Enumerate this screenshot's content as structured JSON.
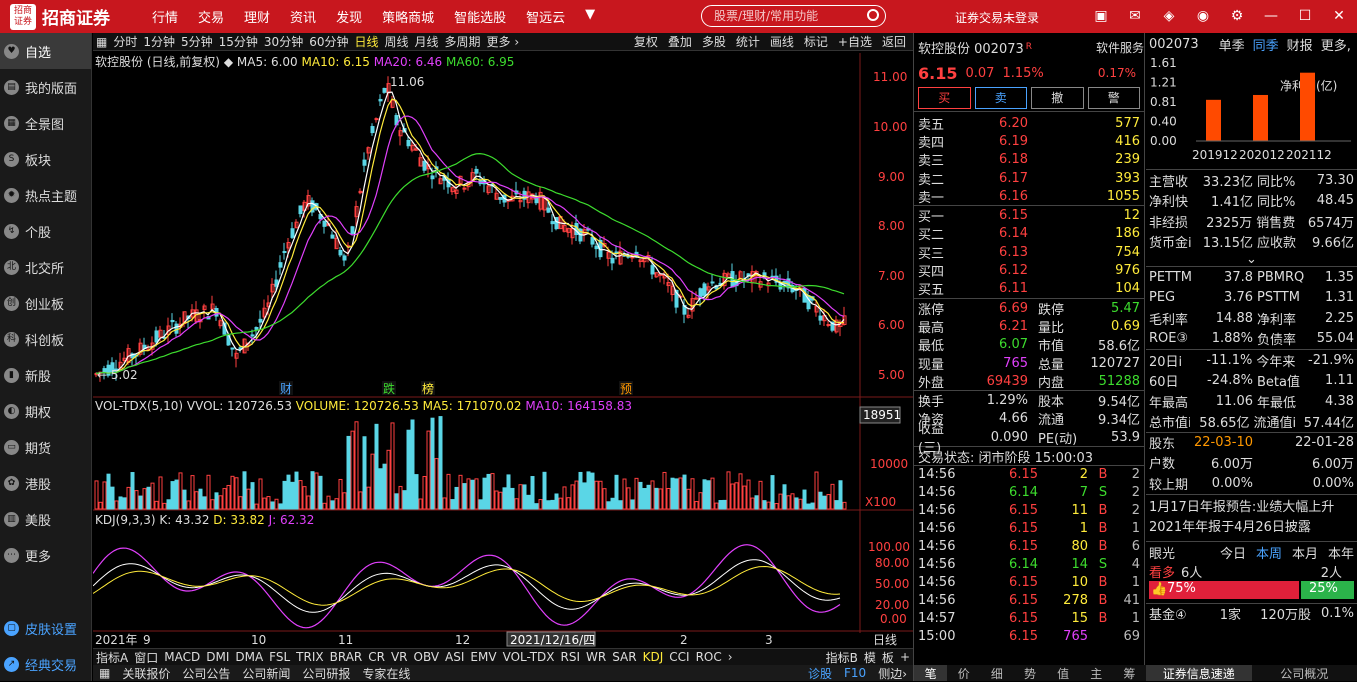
{
  "app": {
    "logo_mark": "招商证券",
    "logo": "招商证券",
    "nav": [
      "行情",
      "交易",
      "理财",
      "资讯",
      "发现",
      "策略商城",
      "智能选股",
      "智远云"
    ],
    "search_placeholder": "股票/理财/常用功能",
    "login": "证券交易未登录"
  },
  "sidebar": {
    "items": [
      "自选",
      "我的版面",
      "全景图",
      "板块",
      "热点主题",
      "个股",
      "北交所",
      "创业板",
      "科创板",
      "新股",
      "期权",
      "期货",
      "港股",
      "美股",
      "更多"
    ],
    "bottom": [
      "皮肤设置",
      "经典交易"
    ]
  },
  "chart": {
    "toolbar": [
      "分时",
      "1分钟",
      "5分钟",
      "15分钟",
      "30分钟",
      "60分钟",
      "日线",
      "周线",
      "月线",
      "多周期",
      "更多 ›"
    ],
    "toolbar_selected": "日线",
    "toolbar_right": [
      "复权",
      "叠加",
      "多股",
      "统计",
      "画线",
      "标记",
      "+自选",
      "返回"
    ],
    "title": "软控股份 (日线,前复权)",
    "ma5": "MA5: 6.00",
    "ma10": "MA10: 6.15",
    "ma20": "MA20: 6.46",
    "ma60": "MA60: 6.95",
    "high_label": "11.06",
    "low_label": "← 5.02",
    "price_axis": [
      "11.00",
      "10.00",
      "9.00",
      "8.00",
      "7.00",
      "6.00",
      "5.00"
    ],
    "markers": [
      "财",
      "跌",
      "榜",
      "预"
    ],
    "vol": {
      "name": "VOL-TDX(5,10)",
      "vvol": "VVOL: 120726.53",
      "volume": "VOLUME: 120726.53",
      "ma5": "MA5: 171070.02",
      "ma10": "MA10: 164158.83",
      "axis_top": "18951",
      "axis_mid": "10000",
      "unit": "X100"
    },
    "kdj": {
      "name": "KDJ(9,3,3)",
      "k": "K: 43.32",
      "d": "D: 33.82",
      "j": "J: 62.32",
      "axis": [
        "100.00",
        "80.00",
        "50.00",
        "20.00",
        "0.00"
      ]
    },
    "dates": {
      "year": "2021年",
      "m9": "9",
      "m10": "10",
      "m11": "11",
      "m12": "12",
      "cursor": "2021/12/16/四",
      "m2": "2",
      "m3": "3",
      "period": "日线"
    },
    "indicator_tabs": [
      "指标A",
      "窗口",
      "MACD",
      "DMI",
      "DMA",
      "FSL",
      "TRIX",
      "BRAR",
      "CR",
      "VR",
      "OBV",
      "ASI",
      "EMV",
      "VOL-TDX",
      "RSI",
      "WR",
      "SAR",
      "KDJ",
      "CCI",
      "ROC",
      "›"
    ],
    "indicator_selected": "KDJ",
    "indicator_right": [
      "指标B",
      "模",
      "板",
      "+"
    ],
    "news": [
      "关联报价",
      "公司公告",
      "公司新闻",
      "公司研报",
      "专家在线"
    ],
    "news_right": [
      "诊股",
      "F10",
      "侧边›"
    ]
  },
  "quote": {
    "name": "软控股份 002073",
    "badge": "R",
    "service": "软件服务",
    "price": "6.15",
    "change": "0.07",
    "pct": "1.15%",
    "sector_pct": "0.17%",
    "actions": [
      "买",
      "卖",
      "撤",
      "警"
    ],
    "asks": [
      [
        "卖五",
        "6.20",
        "577"
      ],
      [
        "卖四",
        "6.19",
        "416"
      ],
      [
        "卖三",
        "6.18",
        "239"
      ],
      [
        "卖二",
        "6.17",
        "393"
      ],
      [
        "卖一",
        "6.16",
        "1055"
      ]
    ],
    "bids": [
      [
        "买一",
        "6.15",
        "12"
      ],
      [
        "买二",
        "6.14",
        "186"
      ],
      [
        "买三",
        "6.13",
        "754"
      ],
      [
        "买四",
        "6.12",
        "976"
      ],
      [
        "买五",
        "6.11",
        "104"
      ]
    ],
    "stats": [
      [
        "涨停",
        "6.69",
        "跌停",
        "5.47"
      ],
      [
        "最高",
        "6.21",
        "量比",
        "0.69"
      ],
      [
        "最低",
        "6.07",
        "市值",
        "58.6亿"
      ],
      [
        "现量",
        "765",
        "总量",
        "120727"
      ],
      [
        "外盘",
        "69439",
        "内盘",
        "51288"
      ]
    ],
    "stats2": [
      [
        "换手",
        "1.29%",
        "股本",
        "9.54亿"
      ],
      [
        "净资",
        "4.66",
        "流通",
        "9.34亿"
      ],
      [
        "收益(三)",
        "0.090",
        "PE(动)",
        "53.9"
      ]
    ],
    "status": "交易状态: 闭市阶段 15:00:03",
    "ticks": [
      [
        "14:56",
        "6.15",
        "2",
        "B",
        "2"
      ],
      [
        "14:56",
        "6.14",
        "7",
        "S",
        "2"
      ],
      [
        "14:56",
        "6.15",
        "11",
        "B",
        "2"
      ],
      [
        "14:56",
        "6.15",
        "1",
        "B",
        "1"
      ],
      [
        "14:56",
        "6.15",
        "80",
        "B",
        "6"
      ],
      [
        "14:56",
        "6.14",
        "14",
        "S",
        "4"
      ],
      [
        "14:56",
        "6.15",
        "10",
        "B",
        "1"
      ],
      [
        "14:56",
        "6.15",
        "278",
        "B",
        "41"
      ],
      [
        "14:57",
        "6.15",
        "15",
        "B",
        "1"
      ],
      [
        "15:00",
        "6.15",
        "765",
        "",
        "69"
      ]
    ],
    "footer_tabs": [
      "笔",
      "价",
      "细",
      "势",
      "值",
      "主",
      "筹"
    ]
  },
  "f10": {
    "code": "002073",
    "tabs": [
      "单季",
      "同季",
      "财报",
      "更多,"
    ],
    "chart_data": {
      "type": "bar",
      "categories": [
        "201912",
        "202012",
        "202112"
      ],
      "values": [
        0.85,
        0.95,
        1.41
      ],
      "ylim": [
        0,
        1.61
      ],
      "yticks": [
        "1.61",
        "1.21",
        "0.81",
        "0.40",
        "0.00"
      ],
      "title": "净利润(亿)"
    },
    "metrics": [
      [
        "主营收",
        "33.23亿",
        "同比%",
        "73.30"
      ],
      [
        "净利快",
        "1.41亿",
        "同比%",
        "48.45"
      ],
      [
        "非经损",
        "2325万",
        "销售费",
        "6574万"
      ],
      [
        "货币金i",
        "13.15亿",
        "应收款",
        "9.66亿"
      ]
    ],
    "ratios": [
      [
        "PETTM",
        "37.8",
        "PBMRQ",
        "1.35"
      ],
      [
        "PEG",
        "3.76",
        "PSTTM",
        "1.31"
      ],
      [
        "毛利率",
        "14.88",
        "净利率",
        "2.25"
      ],
      [
        "ROE③",
        "1.88%",
        "负债率",
        "55.04"
      ]
    ],
    "perf": [
      [
        "20日i",
        "-11.1%",
        "今年来",
        "-21.9%"
      ],
      [
        "60日",
        "-24.8%",
        "Beta值",
        "1.11"
      ],
      [
        "年最高",
        "11.06",
        "年最低",
        "4.38"
      ],
      [
        "总市值i",
        "58.65亿",
        "流通值i",
        "57.44亿"
      ]
    ],
    "holders": {
      "label": "股东",
      "d1": "22-03-10",
      "d2": "22-01-28",
      "rows": [
        [
          "户数",
          "6.00万",
          "6.00万"
        ],
        [
          "较上期",
          "0.00%",
          "0.00%"
        ]
      ]
    },
    "notice": [
      "1月17日年报预告:业绩大幅上升",
      "2021年年报于4月26日披露"
    ],
    "eye": {
      "label": "眼光",
      "tabs": [
        "今日",
        "本周",
        "本月",
        "本年"
      ],
      "bull": "看多",
      "bull_n": "6人",
      "bear_n": "2人",
      "bull_pct": "75%",
      "bear_pct": "25%"
    },
    "fund": {
      "label": "基金④",
      "n": "1家",
      "v": "120万股",
      "p": "0.1%"
    },
    "footer": [
      "证券信息速递",
      "公司概况"
    ]
  }
}
